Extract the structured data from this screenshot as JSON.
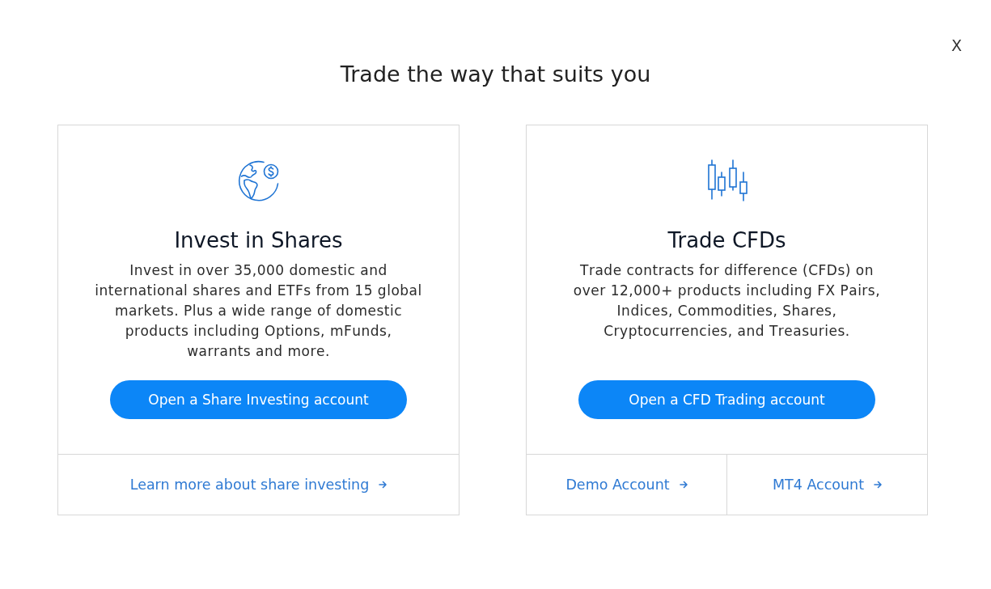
{
  "close_button": "X",
  "title": "Trade the way that suits you",
  "cards": [
    {
      "heading": "Invest in Shares",
      "description": "Invest in over 35,000 domestic and international shares and ETFs from 15 global markets. Plus a wide range of domestic products including Options, mFunds, warrants and more.",
      "button": "Open a Share Investing account",
      "links": [
        "Learn more about share investing"
      ]
    },
    {
      "heading": "Trade CFDs",
      "description": "Trade contracts for difference (CFDs) on over 12,000+ products including FX Pairs, Indices, Commodities, Shares, Cryptocurrencies, and Treasuries.",
      "button": "Open a CFD Trading account",
      "links": [
        "Demo Account",
        "MT4 Account"
      ]
    }
  ]
}
